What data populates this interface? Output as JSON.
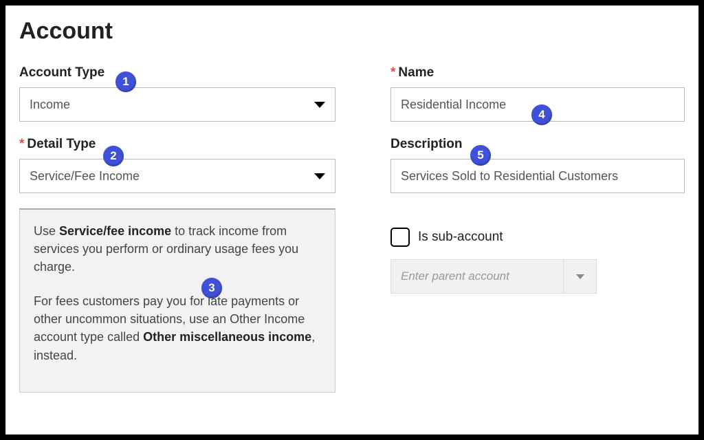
{
  "page_title": "Account",
  "left": {
    "account_type_label": "Account Type",
    "account_type_value": "Income",
    "detail_type_label": "Detail Type",
    "detail_type_value": "Service/Fee Income",
    "info_p1_pre": "Use ",
    "info_p1_bold": "Service/fee income",
    "info_p1_post": " to track income from services you perform or ordinary usage fees you charge.",
    "info_p2_pre": "For fees customers pay you for late payments or other uncommon situations, use an Other Income account type called ",
    "info_p2_bold": "Other miscellaneous income",
    "info_p2_post": ", instead."
  },
  "right": {
    "name_label": "Name",
    "name_value": "Residential Income",
    "description_label": "Description",
    "description_value": "Services Sold to Residential Customers",
    "sub_account_label": "Is sub-account",
    "parent_placeholder": "Enter parent account"
  },
  "badges": {
    "b1": "1",
    "b2": "2",
    "b3": "3",
    "b4": "4",
    "b5": "5"
  }
}
